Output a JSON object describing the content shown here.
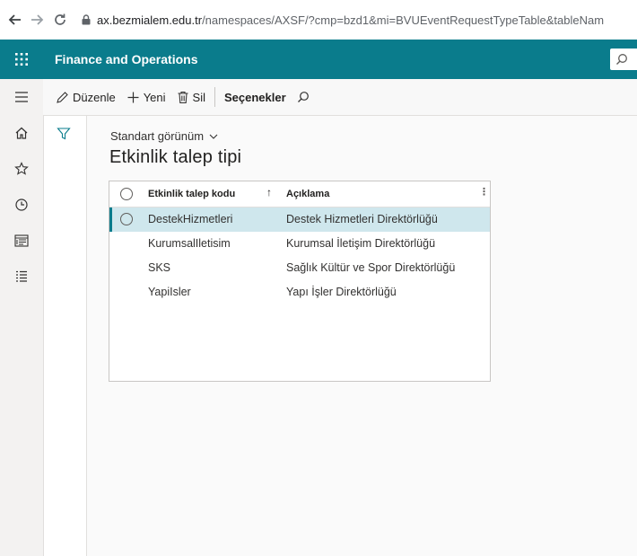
{
  "browser": {
    "url_host": "ax.bezmialem.edu.tr",
    "url_path": "/namespaces/AXSF/?cmp=bzd1&mi=BVUEventRequestTypeTable&tableNam"
  },
  "app": {
    "title": "Finance and Operations",
    "accent_color": "#0a7c8c"
  },
  "nav_rail": {
    "items": [
      "home-icon",
      "star-icon",
      "clock-icon",
      "workspace-icon",
      "modules-icon"
    ]
  },
  "action_pane": {
    "edit_label": "Düzenle",
    "new_label": "Yeni",
    "delete_label": "Sil",
    "options_label": "Seçenekler"
  },
  "view": {
    "selector_label": "Standart görünüm",
    "page_title": "Etkinlik talep tipi"
  },
  "grid": {
    "columns": {
      "code": "Etkinlik talep kodu",
      "description": "Açıklama"
    },
    "sort_indicator": "↑",
    "rows": [
      {
        "code": "DestekHizmetleri",
        "description": "Destek Hizmetleri Direktörlüğü",
        "selected": true
      },
      {
        "code": "KurumsalIletisim",
        "description": "Kurumsal İletişim Direktörlüğü",
        "selected": false
      },
      {
        "code": "SKS",
        "description": "Sağlık Kültür ve Spor Direktörlüğü",
        "selected": false
      },
      {
        "code": "YapiIsler",
        "description": "Yapı İşler Direktörlüğü",
        "selected": false
      }
    ]
  }
}
